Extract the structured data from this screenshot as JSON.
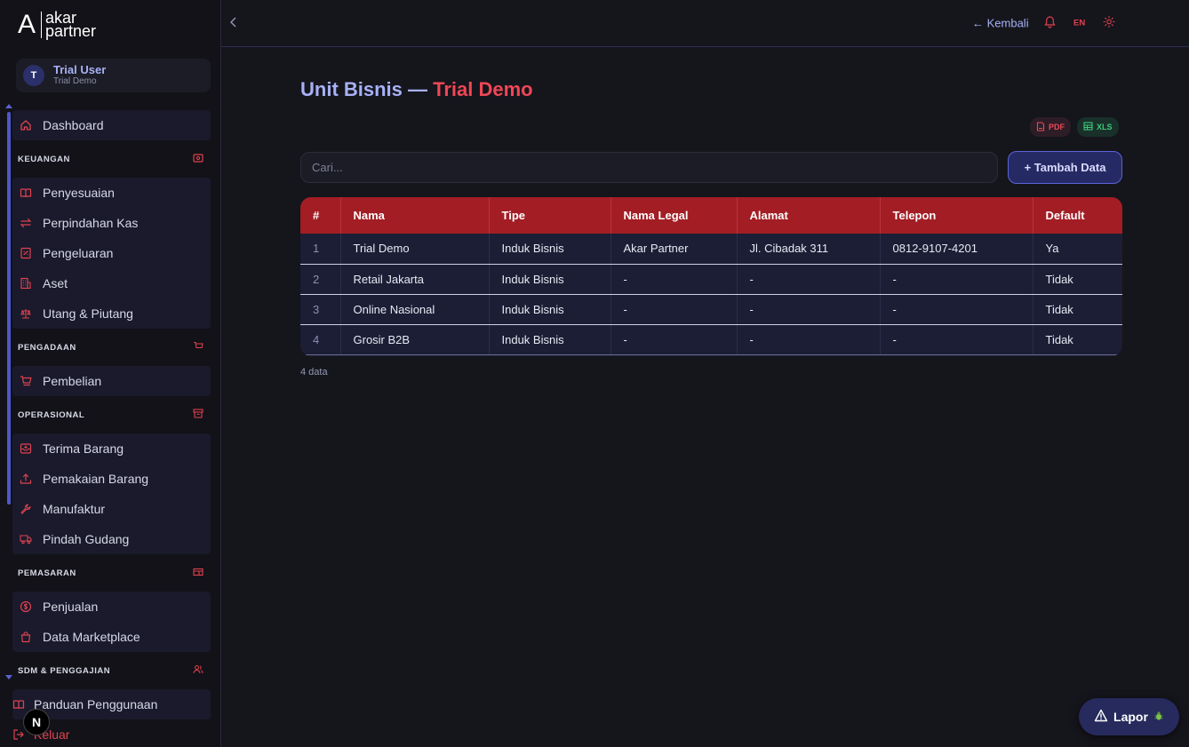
{
  "brand": {
    "mark": "A",
    "line1": "akar",
    "line2": "partner"
  },
  "user": {
    "initial": "T",
    "name": "Trial User",
    "company": "Trial Demo"
  },
  "nav": {
    "dashboard": "Dashboard",
    "sections": [
      {
        "title": "KEUANGAN",
        "icon": "money-icon",
        "items": [
          {
            "label": "Penyesuaian",
            "icon": "book-icon"
          },
          {
            "label": "Perpindahan Kas",
            "icon": "transfer-icon"
          },
          {
            "label": "Pengeluaran",
            "icon": "receipt-icon"
          },
          {
            "label": "Aset",
            "icon": "building-icon"
          },
          {
            "label": "Utang & Piutang",
            "icon": "scale-icon"
          }
        ]
      },
      {
        "title": "PENGADAAN",
        "icon": "cart-icon",
        "items": [
          {
            "label": "Pembelian",
            "icon": "cart-icon"
          }
        ]
      },
      {
        "title": "OPERASIONAL",
        "icon": "archive-icon",
        "items": [
          {
            "label": "Terima Barang",
            "icon": "inbox-icon"
          },
          {
            "label": "Pemakaian Barang",
            "icon": "upload-icon"
          },
          {
            "label": "Manufaktur",
            "icon": "wrench-icon"
          },
          {
            "label": "Pindah Gudang",
            "icon": "truck-icon"
          }
        ]
      },
      {
        "title": "PEMASARAN",
        "icon": "storefront-icon",
        "items": [
          {
            "label": "Penjualan",
            "icon": "dollar-icon"
          },
          {
            "label": "Data Marketplace",
            "icon": "bag-icon"
          }
        ]
      },
      {
        "title": "SDM & PENGGAJIAN",
        "icon": "users-icon",
        "items": []
      }
    ],
    "guide": "Panduan Penggunaan",
    "logout": "Keluar"
  },
  "topbar": {
    "back": "← Kembali",
    "lang": "EN"
  },
  "page": {
    "title_main": "Unit Bisnis —",
    "title_accent": "Trial Demo"
  },
  "export": {
    "pdf": "PDF",
    "xls": "XLS"
  },
  "search": {
    "placeholder": "Cari..."
  },
  "add_button": "+ Tambah Data",
  "table": {
    "headers": [
      "#",
      "Nama",
      "Tipe",
      "Nama Legal",
      "Alamat",
      "Telepon",
      "Default"
    ],
    "rows": [
      [
        "1",
        "Trial Demo",
        "Induk Bisnis",
        "Akar Partner",
        "Jl. Cibadak 311",
        "0812-9107-4201",
        "Ya"
      ],
      [
        "2",
        "Retail Jakarta",
        "Induk Bisnis",
        "-",
        "-",
        "-",
        "Tidak"
      ],
      [
        "3",
        "Online Nasional",
        "Induk Bisnis",
        "-",
        "-",
        "-",
        "Tidak"
      ],
      [
        "4",
        "Grosir B2B",
        "Induk Bisnis",
        "-",
        "-",
        "-",
        "Tidak"
      ]
    ]
  },
  "count": "4 data",
  "report": {
    "label": "Lapor"
  },
  "colors": {
    "accent": "#ef4756",
    "brand": "#a7b1f5",
    "header": "#a31d24",
    "sidebar_group": "#1a1a2c"
  }
}
